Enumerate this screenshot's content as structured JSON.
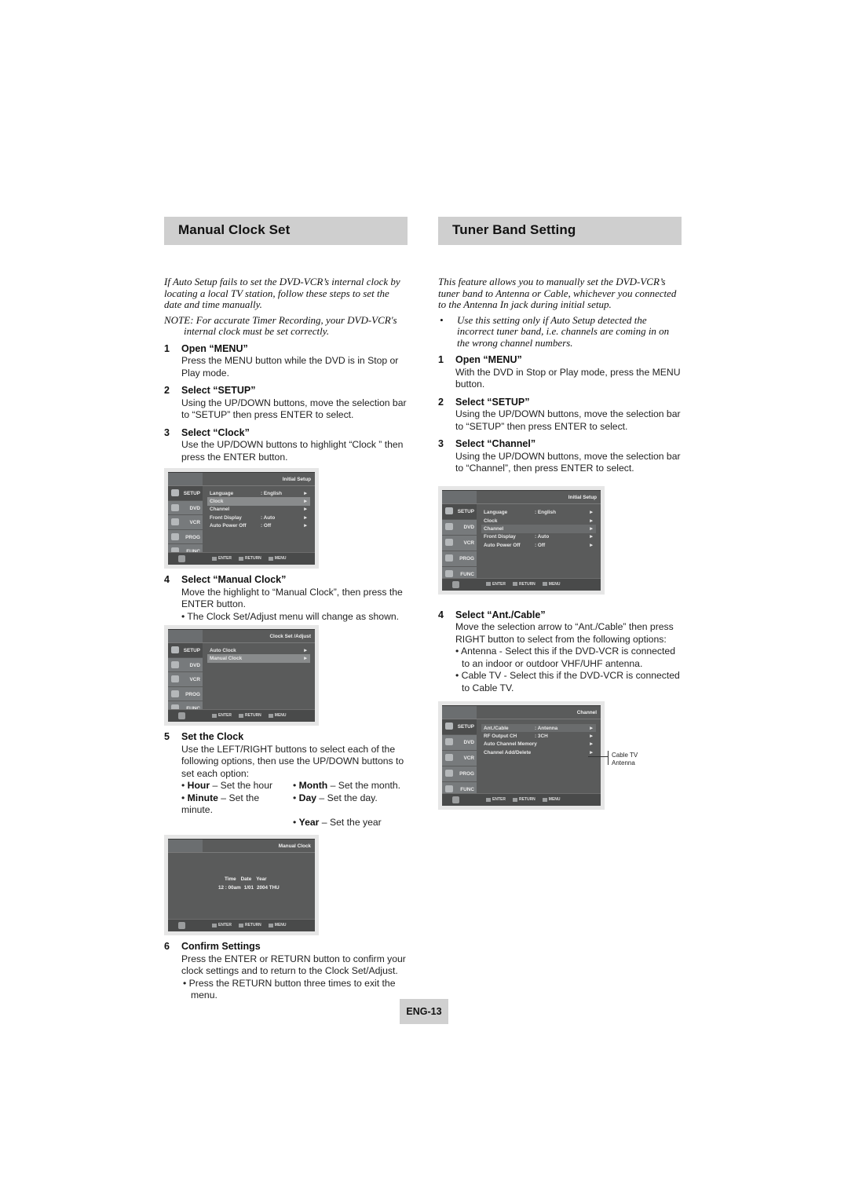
{
  "left": {
    "title": "Manual Clock Set",
    "intro": "If Auto Setup fails to set the DVD-VCR’s internal clock by locating a local TV station, follow these steps to set the date and time manually.",
    "note_line1": "NOTE: For accurate Timer Recording, your DVD-VCR's",
    "note_line2": "internal clock must be set correctly.",
    "steps": [
      {
        "num": "1",
        "head": "Open “MENU”",
        "body": "Press the MENU button while the DVD is in Stop or Play mode."
      },
      {
        "num": "2",
        "head": "Select “SETUP”",
        "body": "Using the UP/DOWN buttons, move the selection bar to “SETUP” then press ENTER to select."
      },
      {
        "num": "3",
        "head": "Select “Clock”",
        "body": "Use the UP/DOWN buttons to highlight “Clock ” then press the ENTER button."
      },
      {
        "num": "4",
        "head": "Select “Manual Clock”",
        "body": "Move the highlight to “Manual Clock”, then press the ENTER button.",
        "sub": "• The Clock Set/Adjust menu will change as shown."
      },
      {
        "num": "5",
        "head": "Set the Clock",
        "body": "Use the LEFT/RIGHT buttons to select each of the following options, then use the UP/DOWN buttons to set each option:"
      },
      {
        "num": "6",
        "head": "Confirm Settings",
        "body": "Press the ENTER or RETURN button to confirm your clock settings and to  return to the Clock Set/Adjust.",
        "sub": "• Press the RETURN button three times to exit the menu."
      }
    ],
    "options": [
      {
        "term": "Hour",
        "desc": " – Set the hour"
      },
      {
        "term": "Month",
        "desc": "  – Set the month."
      },
      {
        "term": "Minute",
        "desc": " – Set the minute."
      },
      {
        "term": "Day",
        "desc": "  – Set the day."
      },
      {
        "term": "",
        "desc": ""
      },
      {
        "term": "Year",
        "desc": " – Set the year"
      }
    ]
  },
  "right": {
    "title": "Tuner Band Setting",
    "intro": "This feature allows you to manually set the DVD-VCR’s tuner band to Antenna or Cable, whichever you connected to the Antenna In jack during initial setup.",
    "bullet": "Use this setting only if Auto Setup detected the incorrect tuner band, i.e. channels are coming in on the  wrong channel numbers.",
    "steps": [
      {
        "num": "1",
        "head": "Open “MENU”",
        "body": "With the DVD in Stop or Play mode, press the MENU button."
      },
      {
        "num": "2",
        "head": "Select “SETUP”",
        "body": "Using the UP/DOWN  buttons, move the selection bar to “SETUP” then press ENTER to select."
      },
      {
        "num": "3",
        "head": "Select “Channel”",
        "body": "Using the UP/DOWN buttons, move the selection bar to “Channel”, then press ENTER to select."
      },
      {
        "num": "4",
        "head": "Select “Ant./Cable”",
        "body": "Move the selection arrow to “Ant./Cable” then press RIGHT button to select from the following options:",
        "sub1": "• Antenna - Select this if the DVD-VCR is connected to an indoor or outdoor VHF/UHF antenna.",
        "sub2": "• Cable TV - Select this if the DVD-VCR is connected to Cable TV."
      }
    ],
    "callout": {
      "line1": "Cable TV",
      "line2": "Antenna"
    }
  },
  "osd": {
    "tabs": [
      "SETUP",
      "DVD",
      "VCR",
      "PROG",
      "FUNC"
    ],
    "keys": [
      "ENTER",
      "RETURN",
      "MENU"
    ],
    "arrow": "►",
    "initial_setup": {
      "title": "Initial Setup",
      "items": [
        {
          "name": "Language",
          "value": ": English"
        },
        {
          "name": "Clock",
          "value": ""
        },
        {
          "name": "Channel",
          "value": ""
        },
        {
          "name": "Front Display",
          "value": ": Auto"
        },
        {
          "name": "Auto Power Off",
          "value": ": Off"
        }
      ]
    },
    "clock_adjust": {
      "title": "Clock Set /Adjust",
      "items": [
        {
          "name": "Auto Clock"
        },
        {
          "name": "Manual Clock"
        }
      ]
    },
    "manual_clock": {
      "title": "Manual Clock",
      "headers": [
        "Time",
        "Date",
        "Year"
      ],
      "values": [
        "12 : 00am",
        "1/01",
        "2004 THU"
      ]
    },
    "channel": {
      "title": "Channel",
      "items": [
        {
          "name": "Ant./Cable",
          "value": ": Antenna"
        },
        {
          "name": "RF Output CH",
          "value": ": 3CH"
        },
        {
          "name": "Auto Channel Memory",
          "value": ""
        },
        {
          "name": "Channel Add/Delete",
          "value": ""
        }
      ]
    }
  },
  "page_number": "ENG-13"
}
